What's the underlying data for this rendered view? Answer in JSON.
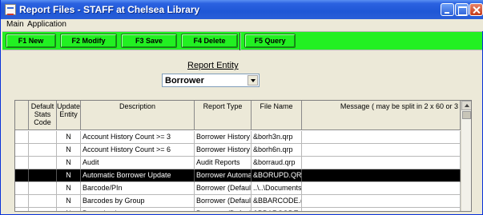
{
  "window": {
    "title": "Report Files - STAFF at Chelsea Library"
  },
  "menu": [
    "Main",
    "Application"
  ],
  "toolbar": {
    "buttons": [
      "F1 New",
      "F2 Modify",
      "F3 Save",
      "F4 Delete",
      "F5 Query"
    ]
  },
  "entity": {
    "label": "Report Entity",
    "selected": "Borrower"
  },
  "grid": {
    "headers": [
      "Default Stats Code",
      "Update Entity",
      "Description",
      "Report Type",
      "File Name",
      "Message ( may be split in 2 x 60 or 3"
    ],
    "rows": [
      {
        "stats": "",
        "update": "N",
        "description": "Account History Count >= 3",
        "type": "Borrower History",
        "file": "&borh3n.qrp",
        "message": ""
      },
      {
        "stats": "",
        "update": "N",
        "description": "Account History Count >= 6",
        "type": "Borrower History",
        "file": "&borh6n.qrp",
        "message": ""
      },
      {
        "stats": "",
        "update": "N",
        "description": "Audit",
        "type": "Audit Reports",
        "file": "&borraud.qrp",
        "message": ""
      },
      {
        "stats": "",
        "update": "N",
        "description": "Automatic Borrower Update",
        "type": "Borrower Automa",
        "file": "&BORUPD.QR",
        "message": ""
      },
      {
        "stats": "",
        "update": "N",
        "description": "Barcode/PIn",
        "type": "Borrower (Defaul",
        "file": "..\\..\\Documents",
        "message": ""
      },
      {
        "stats": "",
        "update": "N",
        "description": "Barcodes by Group",
        "type": "Borrower (Defaul",
        "file": "&BBARCODE.(",
        "message": ""
      },
      {
        "stats": "",
        "update": "N",
        "description": "Barcodes by name",
        "type": "Borrower (Defaul",
        "file": "&BBARCODE.(",
        "message": ""
      }
    ],
    "selected_row": 3
  },
  "colors": {
    "titlebar": "#2b62e0",
    "toolbar_green": "#22f022",
    "selection": "#000000"
  },
  "icons": {
    "window": "report-files-icon",
    "minimize": "minimize-icon",
    "maximize": "maximize-icon",
    "close": "close-icon",
    "dropdown": "chevron-down-icon",
    "scroll_up": "scroll-up-arrow-icon"
  }
}
